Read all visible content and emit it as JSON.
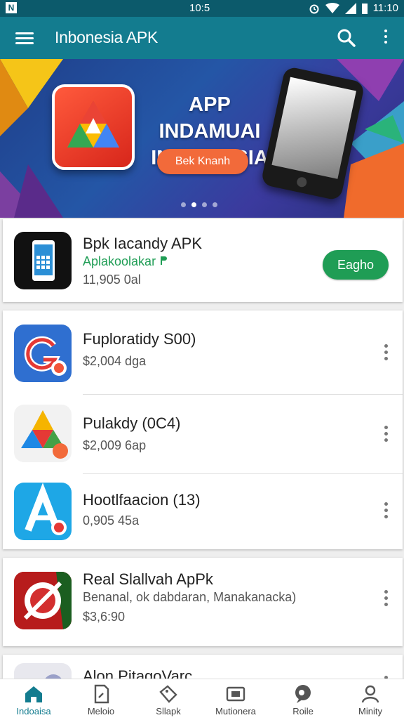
{
  "statusbar": {
    "time": "10:5",
    "clock": "11:10"
  },
  "appbar": {
    "title": "Inbonesia APK"
  },
  "banner": {
    "headline_line1": "APP INDAMUAI",
    "headline_line2": "INDIANESIA",
    "cta_label": "Bek Knanh",
    "slide_index": 2,
    "slide_count": 4
  },
  "featured": {
    "name": "Bpk Iacandy APK",
    "developer": "Aplakoolakar",
    "meta": "11,905 0al",
    "install_label": "Eagho"
  },
  "list": [
    {
      "name": "Fuploratidy S00)",
      "sub": "$2,004 dga"
    },
    {
      "name": "Pulakdy (0C4)",
      "sub": "$2,009 6ap"
    },
    {
      "name": "Hootlfaacion (13)",
      "sub": "0,905 45a"
    }
  ],
  "card3": {
    "name": "Real Slallvah ApPk",
    "sub": "Benanal, ok dabdaran, Manakanacka)",
    "price": "$3,6:90"
  },
  "card4": {
    "name": "Alon PitagoVarc"
  },
  "nav": [
    {
      "label": "Indoaisa"
    },
    {
      "label": "Meloio"
    },
    {
      "label": "Sllapk"
    },
    {
      "label": "Mutionera"
    },
    {
      "label": "Roile"
    },
    {
      "label": "Minity"
    }
  ],
  "colors": {
    "appbar": "#137c8f",
    "statusbar": "#0c5a6b",
    "install": "#1f9d55",
    "cta": "#f26a3a"
  }
}
